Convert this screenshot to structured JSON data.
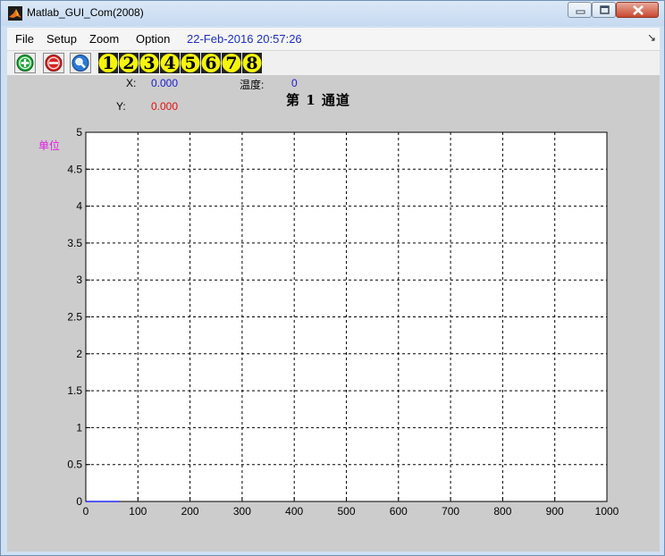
{
  "window": {
    "title": "Matlab_GUI_Com(2008)",
    "controls": [
      "minimize",
      "maximize",
      "close"
    ]
  },
  "menu": {
    "items": [
      "File",
      "Setup",
      "Zoom",
      "Option"
    ],
    "datetime": "22-Feb-2016 20:57:26",
    "overflow_glyph": "↘"
  },
  "toolbar": {
    "tools": [
      {
        "icon": "zoom-in-icon"
      },
      {
        "icon": "zoom-out-icon"
      },
      {
        "icon": "zoom-search-icon"
      }
    ],
    "channels": [
      "1",
      "2",
      "3",
      "4",
      "5",
      "6",
      "7",
      "8"
    ]
  },
  "readouts": {
    "x_label": "X:",
    "x_value": "0.000",
    "y_label": "Y:",
    "y_value": "0.000",
    "temp_label": "温度:",
    "temp_value": "0"
  },
  "plot": {
    "title": "第 1 通道",
    "unit_label": "单位"
  },
  "colors": {
    "x_value": "#1a1ad0",
    "y_value": "#e01010",
    "temp_value": "#1a1ad0",
    "unit_label": "#e020e0",
    "series": "#0000ff",
    "channel_button": "#f5f50a"
  },
  "chart_data": {
    "type": "line",
    "title": "第 1 通道",
    "xlabel": "",
    "ylabel": "单位",
    "xlim": [
      0,
      1000
    ],
    "ylim": [
      0,
      5
    ],
    "xticks": [
      0,
      100,
      200,
      300,
      400,
      500,
      600,
      700,
      800,
      900,
      1000
    ],
    "yticks": [
      0,
      0.5,
      1,
      1.5,
      2,
      2.5,
      3,
      3.5,
      4,
      4.5,
      5
    ],
    "xtick_labels": [
      "0",
      "100",
      "200",
      "300",
      "400",
      "500",
      "600",
      "700",
      "800",
      "900",
      "1000"
    ],
    "ytick_labels": [
      "0",
      "0.5",
      "1",
      "1.5",
      "2",
      "2.5",
      "3",
      "3.5",
      "4",
      "4.5",
      "5"
    ],
    "grid": true,
    "grid_style": "dashed",
    "series": [
      {
        "x": [
          0,
          65
        ],
        "y": [
          0,
          0
        ]
      }
    ]
  }
}
